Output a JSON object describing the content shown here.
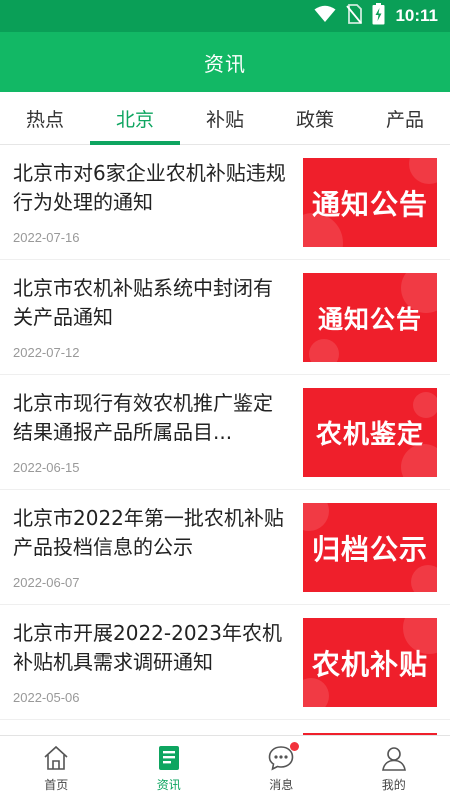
{
  "status_bar": {
    "time": "10:11",
    "icons": [
      "wifi-icon",
      "no-sim-icon",
      "battery-charging-icon"
    ]
  },
  "app_bar": {
    "title": "资讯"
  },
  "tabs": [
    {
      "label": "热点",
      "active": false
    },
    {
      "label": "北京",
      "active": true
    },
    {
      "label": "补贴",
      "active": false
    },
    {
      "label": "政策",
      "active": false
    },
    {
      "label": "产品",
      "active": false
    }
  ],
  "articles": [
    {
      "title": "北京市对6家企业农机补贴违规行为处理的通知",
      "date": "2022-07-16",
      "thumb_text": "通知公告"
    },
    {
      "title": "北京市农机补贴系统中封闭有关产品通知",
      "date": "2022-07-12",
      "thumb_text": "通知公告"
    },
    {
      "title": "北京市现行有效农机推广鉴定结果通报产品所属品目...",
      "date": "2022-06-15",
      "thumb_text": "农机鉴定"
    },
    {
      "title": "北京市2022年第一批农机补贴产品投档信息的公示",
      "date": "2022-06-07",
      "thumb_text": "归档公示"
    },
    {
      "title": "北京市开展2022-2023年农机补贴机具需求调研通知",
      "date": "2022-05-06",
      "thumb_text": "农机补贴"
    }
  ],
  "bottom_nav": [
    {
      "label": "首页",
      "icon": "home-icon",
      "active": false
    },
    {
      "label": "资讯",
      "icon": "news-icon",
      "active": true
    },
    {
      "label": "消息",
      "icon": "message-icon",
      "active": false,
      "badge": true
    },
    {
      "label": "我的",
      "icon": "profile-icon",
      "active": false
    }
  ],
  "colors": {
    "status_bar": "#0a9f57",
    "app_bar": "#12b865",
    "accent": "#0ea560",
    "thumb_red": "#ef1f2b",
    "badge_red": "#f2323c"
  }
}
